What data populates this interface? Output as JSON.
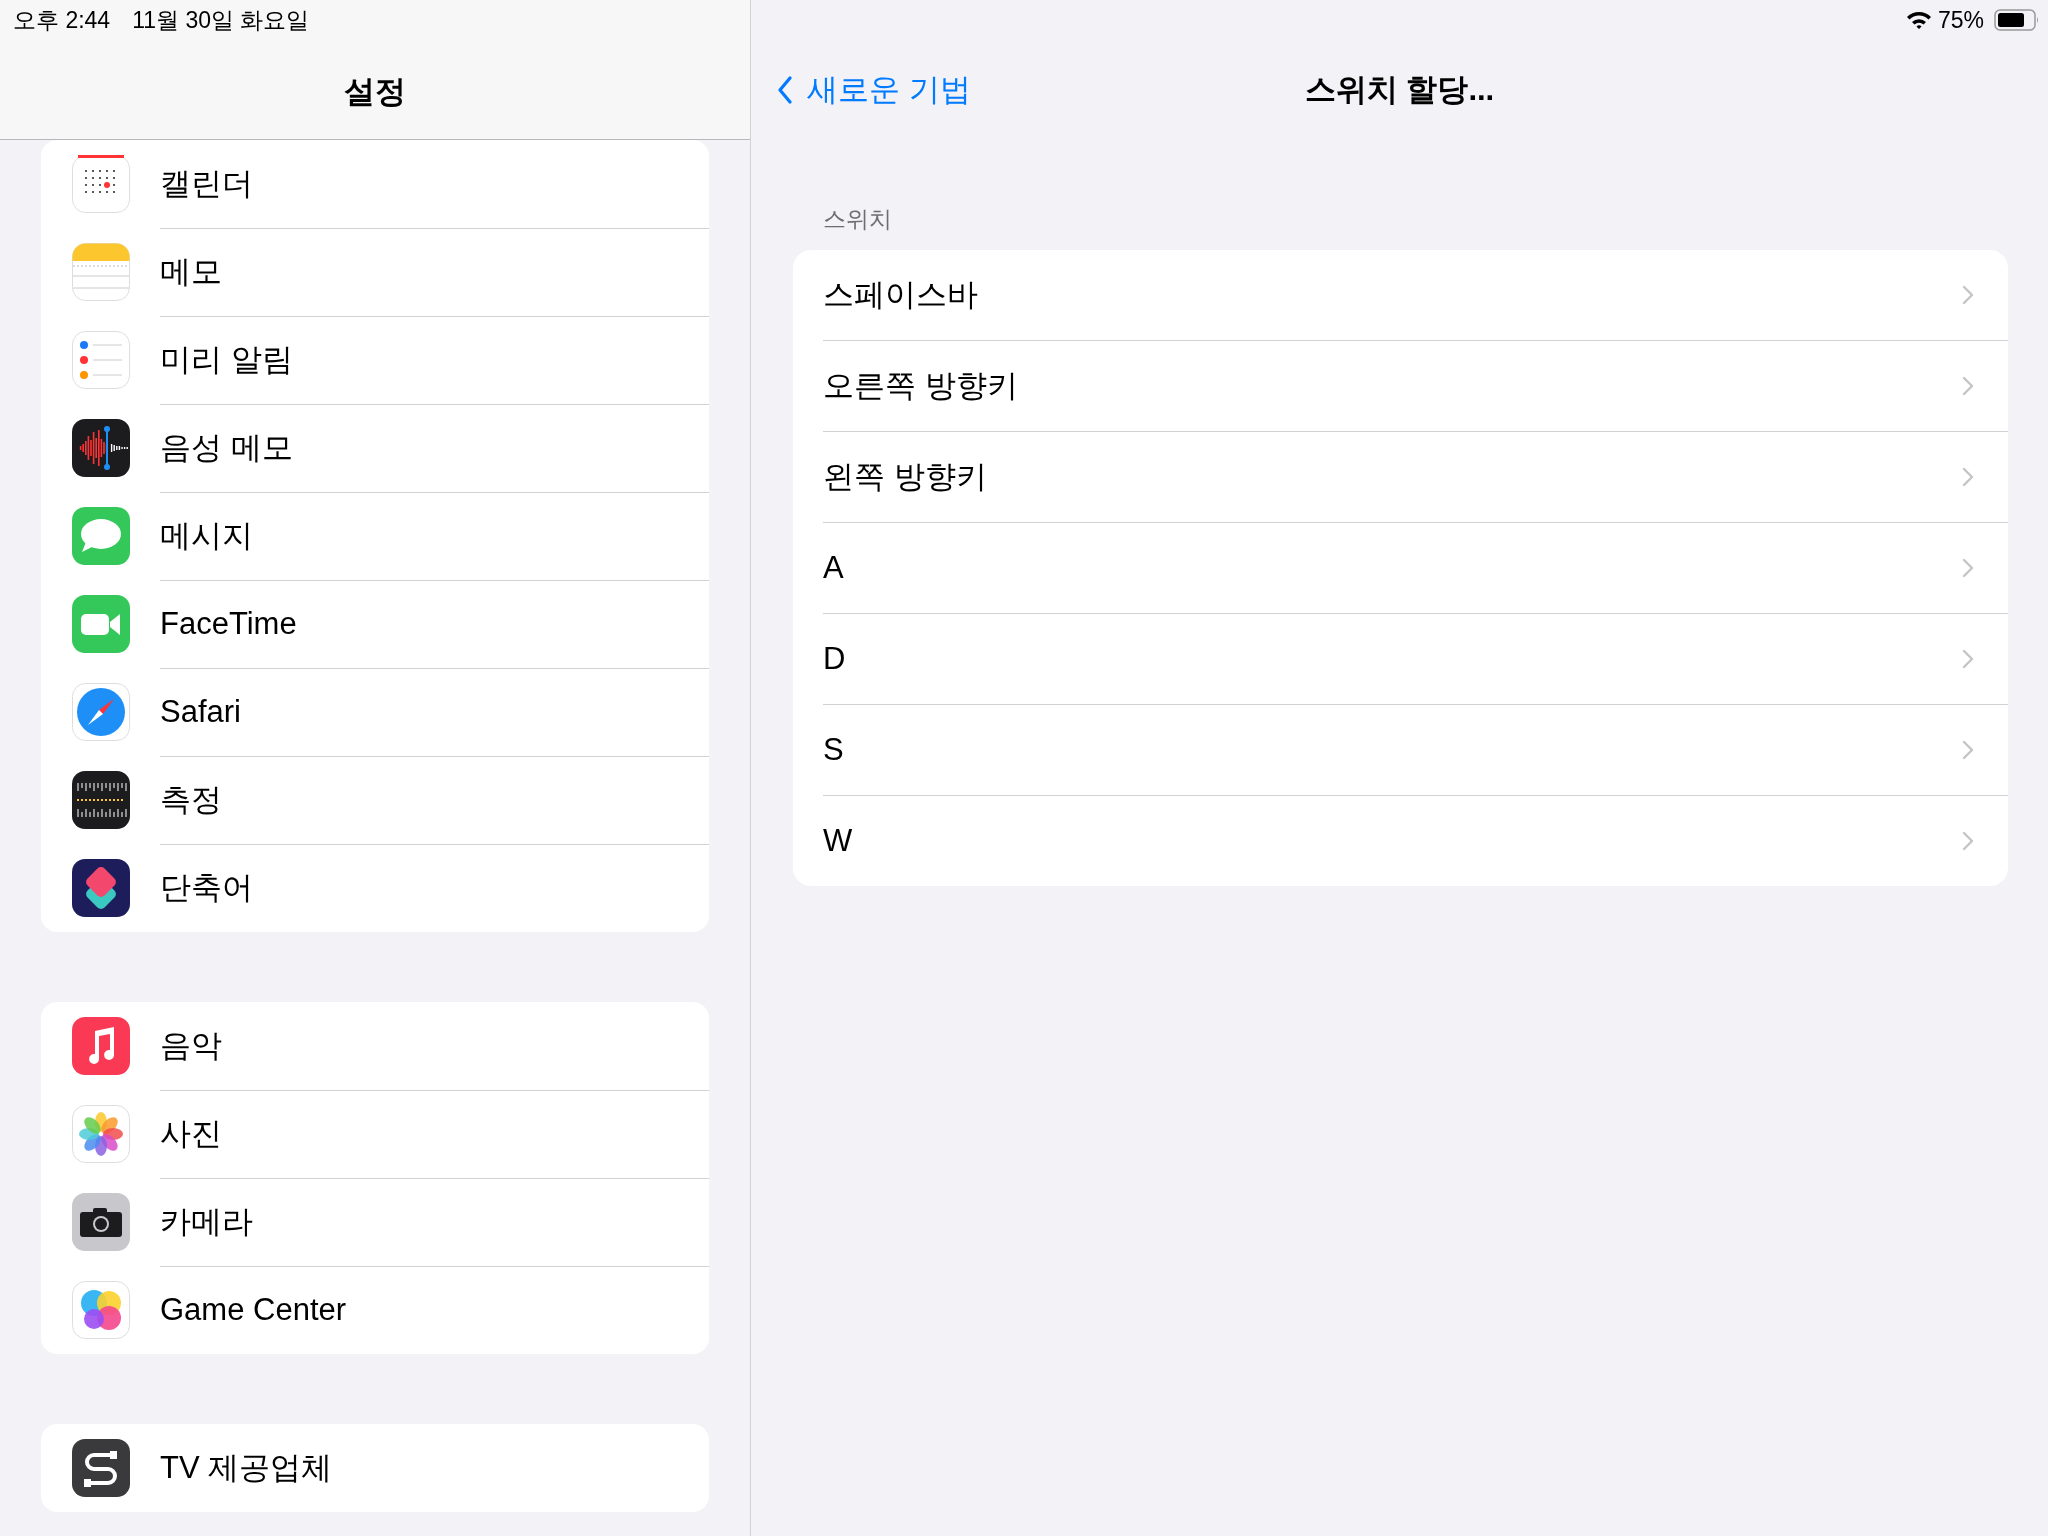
{
  "status_bar": {
    "time": "오후 2:44",
    "date": "11월 30일 화요일",
    "battery": "75%"
  },
  "sidebar": {
    "title": "설정",
    "groups": [
      {
        "items": [
          {
            "label": "캘린더"
          },
          {
            "label": "메모"
          },
          {
            "label": "미리 알림"
          },
          {
            "label": "음성 메모"
          },
          {
            "label": "메시지"
          },
          {
            "label": "FaceTime"
          },
          {
            "label": "Safari"
          },
          {
            "label": "측정"
          },
          {
            "label": "단축어"
          }
        ]
      },
      {
        "items": [
          {
            "label": "음악"
          },
          {
            "label": "사진"
          },
          {
            "label": "카메라"
          },
          {
            "label": "Game Center"
          }
        ]
      },
      {
        "items": [
          {
            "label": "TV 제공업체"
          }
        ]
      }
    ]
  },
  "detail": {
    "back": "새로운 기법",
    "title": "스위치 할당...",
    "section": "스위치",
    "rows": [
      {
        "label": "스페이스바"
      },
      {
        "label": "오른쪽 방향키"
      },
      {
        "label": "왼쪽 방향키"
      },
      {
        "label": "A"
      },
      {
        "label": "D"
      },
      {
        "label": "S"
      },
      {
        "label": "W"
      }
    ]
  }
}
